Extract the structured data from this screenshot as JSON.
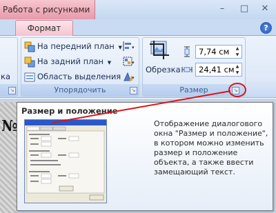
{
  "titlebar": {
    "context_tab": "Работа с рисунками"
  },
  "window_controls": {
    "minimize": "–",
    "maximize": "□",
    "close": "✕"
  },
  "tabs": {
    "format": "Формат",
    "help": "?"
  },
  "arrange_group": {
    "label": "Упорядочить",
    "left_partial": "ка",
    "bring_front": "На передний план",
    "send_back": "На задний план",
    "selection_pane": "Область выделения"
  },
  "size_group": {
    "label": "Размер",
    "crop": "Обрезка",
    "height_value": "7,74 см",
    "width_value": "24,41 см"
  },
  "tooltip": {
    "title": "Размер и положение",
    "body": "Отображение диалогового окна \"Размер и положение\", в котором можно изменить размер и положение объекта, а также ввести замещающий текст."
  },
  "document": {
    "visible_char": "№"
  },
  "colors": {
    "accent_pink": "#e79aac",
    "ribbon_blue": "#dfe9f8",
    "callout_red": "#d8141a"
  }
}
